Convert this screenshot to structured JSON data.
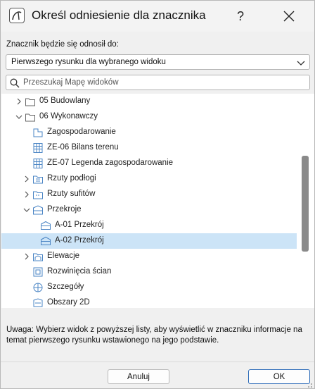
{
  "dialog": {
    "title": "Określ odniesienie dla znacznika",
    "help_label": "?",
    "reference_label": "Znacznik będzie się odnosił do:",
    "reference_value": "Pierwszego rysunku dla wybranego widoku",
    "search_placeholder": "Przeszukaj Mapę widoków",
    "note": "Uwaga: Wybierz widok z powyższej listy, aby wyświetlić w znaczniku informacje na temat pierwszego rysunku wstawionego na jego podstawie.",
    "cancel_label": "Anuluj",
    "ok_label": "OK"
  },
  "tree": {
    "items": [
      {
        "label": "05 Budowlany",
        "icon": "folder-icon",
        "expander": "collapsed"
      },
      {
        "label": "06 Wykonawczy",
        "icon": "folder-icon",
        "expander": "expanded"
      },
      {
        "label": "Zagospodarowanie",
        "icon": "site-plan-icon",
        "expander": "none"
      },
      {
        "label": "ZE-06 Bilans terenu",
        "icon": "schedule-icon",
        "expander": "none"
      },
      {
        "label": "ZE-07 Legenda zagospodarowanie",
        "icon": "schedule-icon",
        "expander": "none"
      },
      {
        "label": "Rzuty podłogi",
        "icon": "floor-plan-folder-icon",
        "expander": "collapsed"
      },
      {
        "label": "Rzuty sufitów",
        "icon": "ceiling-plan-folder-icon",
        "expander": "collapsed"
      },
      {
        "label": "Przekroje",
        "icon": "section-folder-icon",
        "expander": "expanded"
      },
      {
        "label": "A-01 Przekrój",
        "icon": "section-icon",
        "expander": "none",
        "selected": false
      },
      {
        "label": "A-02 Przekrój",
        "icon": "section-icon",
        "expander": "none",
        "selected": true
      },
      {
        "label": "Elewacje",
        "icon": "elevation-folder-icon",
        "expander": "collapsed"
      },
      {
        "label": "Rozwinięcia ścian",
        "icon": "interior-elevation-icon",
        "expander": "none"
      },
      {
        "label": "Szczegóły",
        "icon": "detail-icon",
        "expander": "none"
      },
      {
        "label": "Obszary 2D",
        "icon": "worksheet-icon",
        "expander": "none"
      }
    ]
  },
  "colors": {
    "selection": "#cce4f7",
    "accent": "#2c6bb8",
    "icon_stroke": "#4a84c4"
  }
}
